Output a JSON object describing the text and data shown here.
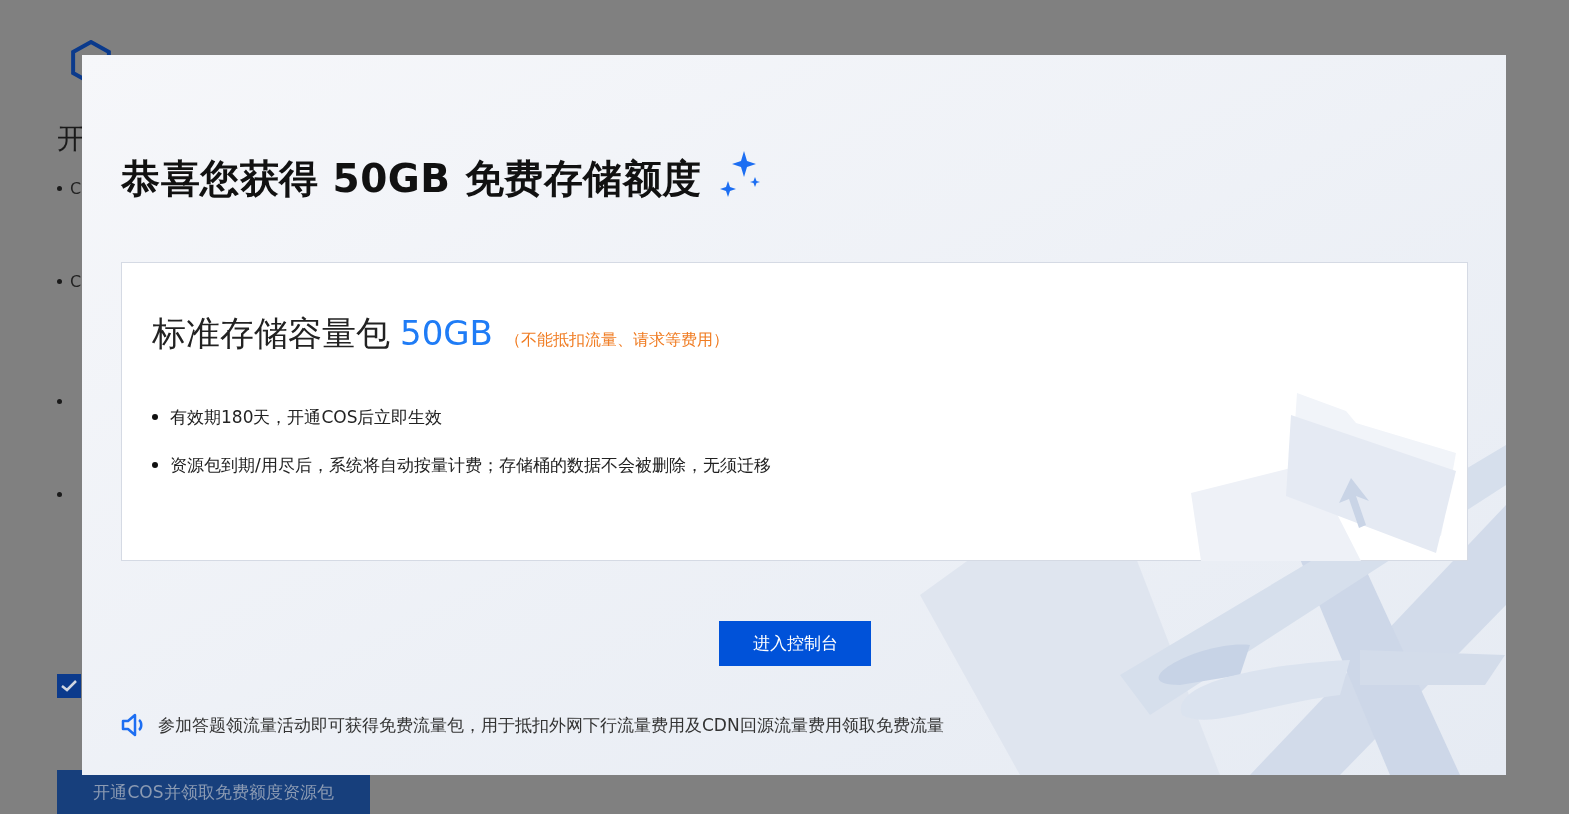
{
  "background_page": {
    "heading": "开",
    "bullet_texts": [
      "C",
      "C"
    ],
    "agree_checkbox": {
      "checked": true
    },
    "submit_button": "开通COS并领取免费额度资源包"
  },
  "dialog": {
    "title": "恭喜您获得 50GB 免费存储额度",
    "card": {
      "title": "标准存储容量包",
      "amount": "50GB",
      "note": "（不能抵扣流量、请求等费用）",
      "bullets": [
        "有效期180天，开通COS后立即生效",
        "资源包到期/用尽后，系统将自动按量计费；存储桶的数据不会被删除，无须迁移"
      ]
    },
    "primary_button": "进入控制台",
    "notice": "参加答题领流量活动即可获得免费流量包，用于抵扣外网下行流量费用及CDN回源流量费用领取免费流量"
  }
}
